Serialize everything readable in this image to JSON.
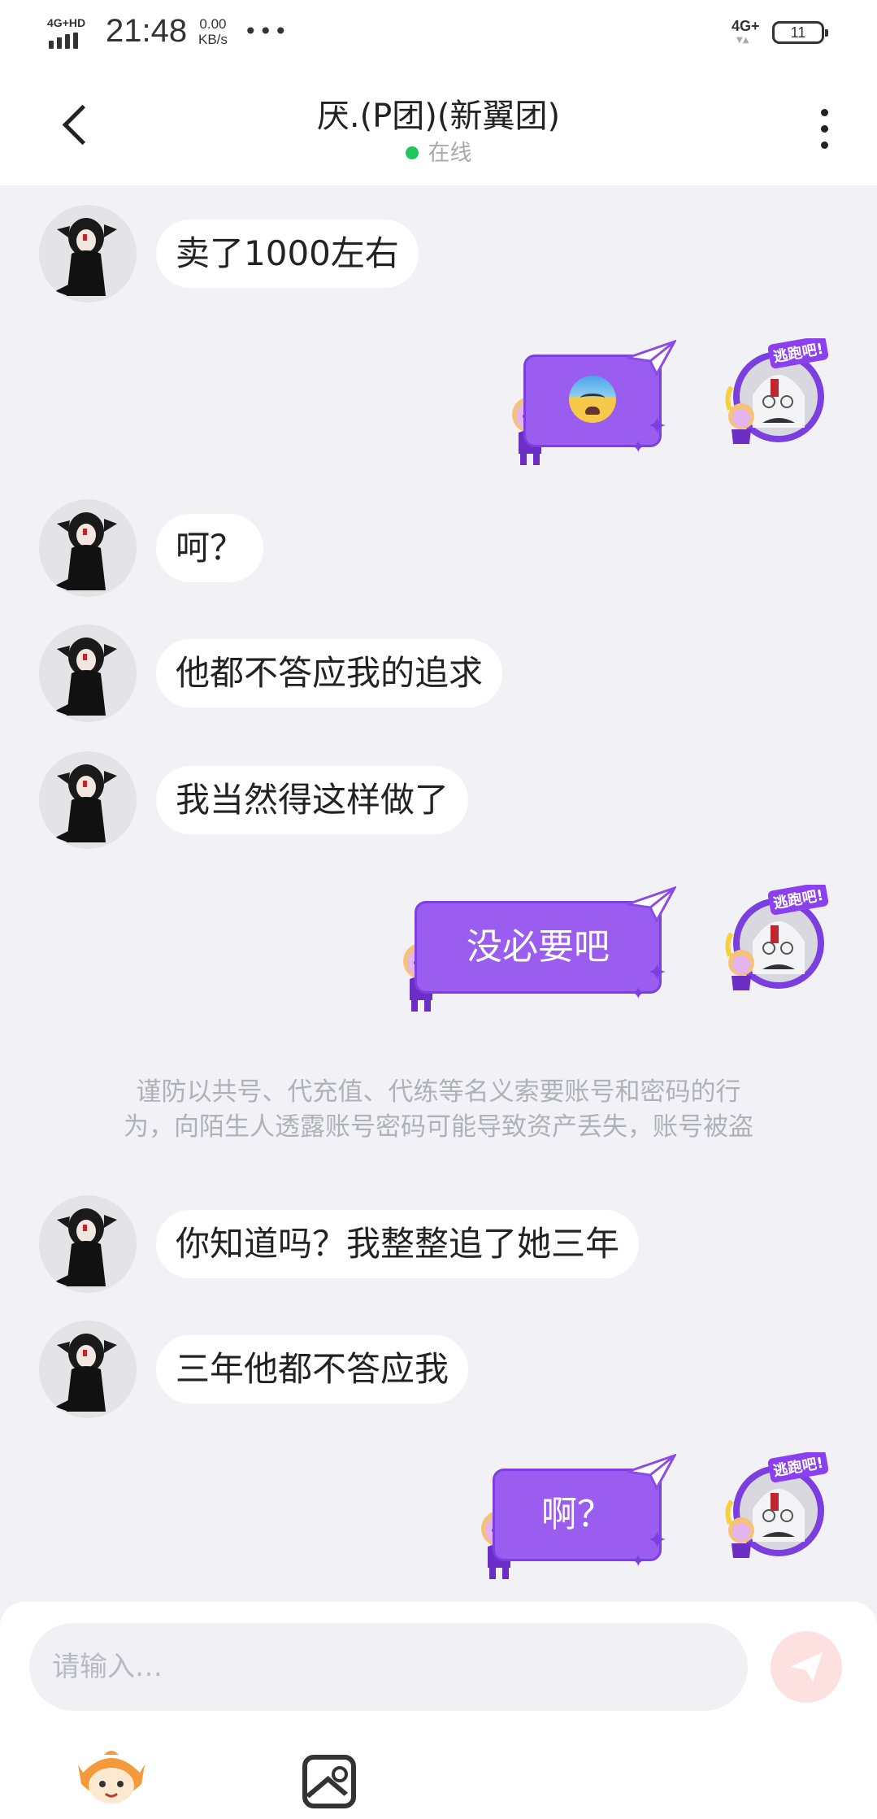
{
  "status_bar": {
    "network_label": "4G+HD",
    "time": "21:48",
    "speed_value": "0.00",
    "speed_unit": "KB/s",
    "more": "•••",
    "right_network": "4G+",
    "battery": "11"
  },
  "header": {
    "title": "厌.(P团)(新翼团)",
    "status": "在线"
  },
  "messages": [
    {
      "side": "left",
      "text": "卖了1000左右"
    },
    {
      "side": "right",
      "emoji": "anxious-sweat-emoji"
    },
    {
      "side": "left",
      "text": "呵？"
    },
    {
      "side": "left",
      "text": "他都不答应我的追求"
    },
    {
      "side": "left",
      "text": "我当然得这样做了"
    },
    {
      "side": "right",
      "text": "没必要吧"
    },
    {
      "side": "left",
      "text": "你知道吗？我整整追了她三年"
    },
    {
      "side": "left",
      "text": "三年他都不答应我"
    },
    {
      "side": "right",
      "text": "啊？"
    }
  ],
  "notice": {
    "line1": "谨防以共号、代充值、代练等名义索要账号和密码的行",
    "line2": "为，向陌生人透露账号密码可能导致资产丢失，账号被盗"
  },
  "avatar_badge": "逃跑吧!",
  "input": {
    "placeholder": "请输入…",
    "value": ""
  },
  "colors": {
    "accent_purple": "#9b5cf0",
    "online_green": "#22c55e",
    "send_disabled": "#fde1e1"
  }
}
